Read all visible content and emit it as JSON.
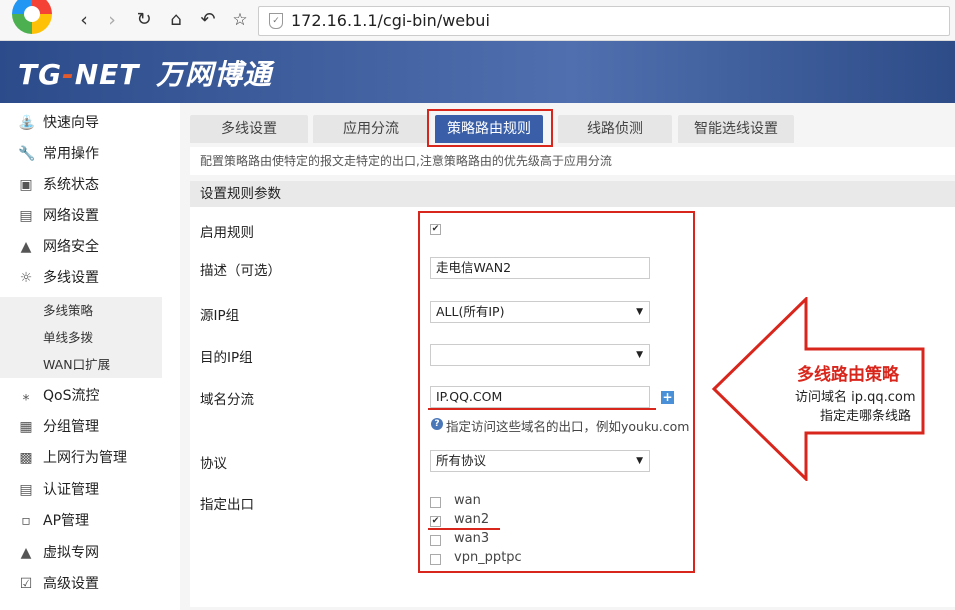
{
  "browser": {
    "back_icon": "back-arrow",
    "url": "172.16.1.1/cgi-bin/webui"
  },
  "header": {
    "brand_tg": "TG",
    "brand_sep": "-",
    "brand_net": "NET",
    "brand_cn": "万网博通"
  },
  "sidebar": {
    "items": [
      {
        "label": "快速向导",
        "icon": "wizard-icon"
      },
      {
        "label": "常用操作",
        "icon": "wrench-icon"
      },
      {
        "label": "系统状态",
        "icon": "monitor-icon"
      },
      {
        "label": "网络设置",
        "icon": "network-icon"
      },
      {
        "label": "网络安全",
        "icon": "security-icon"
      },
      {
        "label": "多线设置",
        "icon": "multiline-icon"
      }
    ],
    "subitems": [
      "多线策略",
      "单线多拨",
      "WAN口扩展"
    ],
    "items2": [
      {
        "label": "QoS流控",
        "icon": "qos-icon"
      },
      {
        "label": "分组管理",
        "icon": "group-icon"
      },
      {
        "label": "上网行为管理",
        "icon": "behavior-icon"
      },
      {
        "label": "认证管理",
        "icon": "auth-icon"
      },
      {
        "label": "AP管理",
        "icon": "ap-icon"
      },
      {
        "label": "虚拟专网",
        "icon": "vpn-icon"
      },
      {
        "label": "高级设置",
        "icon": "advanced-icon"
      }
    ]
  },
  "tabs": [
    {
      "label": "多线设置"
    },
    {
      "label": "应用分流"
    },
    {
      "label": "策略路由规则"
    },
    {
      "label": "线路侦测"
    },
    {
      "label": "智能选线设置"
    }
  ],
  "description": "配置策略路由使特定的报文走特定的出口,注意策略路由的优先级高于应用分流",
  "section_title": "设置规则参数",
  "form": {
    "enable_label": "启用规则",
    "desc_label": "描述（可选）",
    "desc_value": "走电信WAN2",
    "src_ip_label": "源IP组",
    "src_ip_value": "ALL(所有IP)",
    "dst_ip_label": "目的IP组",
    "dst_ip_value": "",
    "domain_label": "域名分流",
    "domain_value": "IP.QQ.COM",
    "domain_help": "指定访问这些域名的出口，例如youku.com",
    "protocol_label": "协议",
    "protocol_value": "所有协议",
    "exit_label": "指定出口",
    "exits": [
      {
        "label": "wan",
        "checked": false
      },
      {
        "label": "wan2",
        "checked": true
      },
      {
        "label": "wan3",
        "checked": false
      },
      {
        "label": "vpn_pptpc",
        "checked": false
      }
    ]
  },
  "annotation": {
    "title": "多线路由策略",
    "line1": "访问域名 ip.qq.com",
    "line2": "指定走哪条线路"
  },
  "colors": {
    "header_blue": "#3a5fa8",
    "annotation_red": "#d9261c"
  }
}
